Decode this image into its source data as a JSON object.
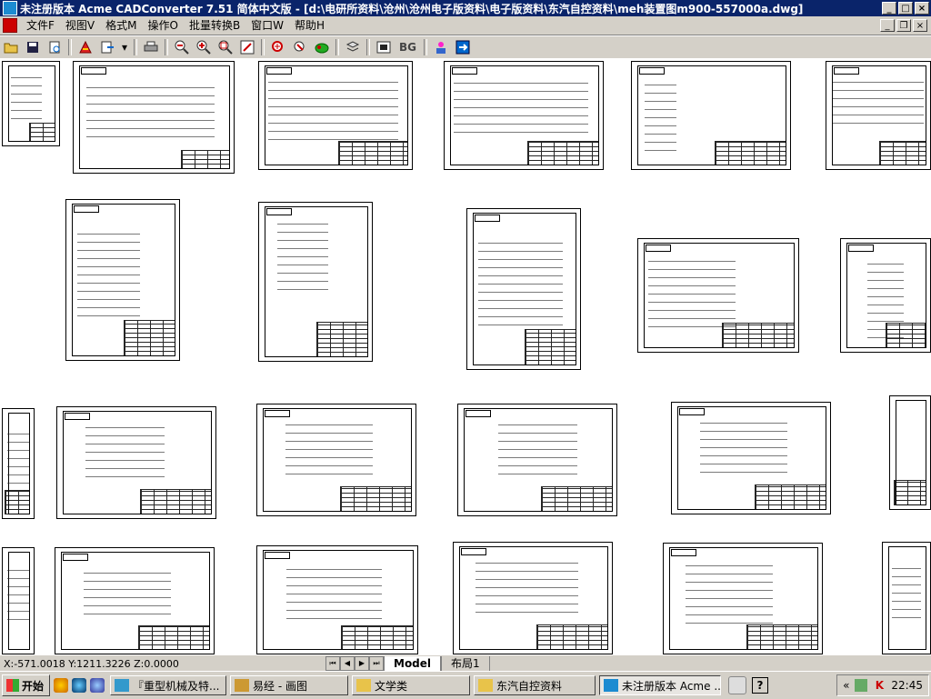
{
  "window": {
    "title": "未注册版本 Acme CADConverter 7.51 简体中文版 - [d:\\电研所资料\\沧州\\沧州电子版资料\\电子版资料\\东汽自控资料\\meh装置图m900-557000a.dwg]"
  },
  "menu": [
    "文件F",
    "视图V",
    "格式M",
    "操作O",
    "批量转换B",
    "窗口W",
    "帮助H"
  ],
  "toolbar": {
    "icons": [
      "open-icon",
      "save-icon",
      "print-preview-icon",
      "convert-icon",
      "export-icon",
      "print-icon",
      "zoom-out-icon",
      "zoom-in-icon",
      "zoom-window-icon",
      "pan-icon",
      "zoom-realtime-icon",
      "zoom-previous-icon",
      "zoom-extents-icon",
      "layers-icon",
      "background-icon",
      "about-icon",
      "exit-icon"
    ],
    "bg_label": "BG"
  },
  "status": {
    "coords": "X:-571.0018 Y:1211.3226 Z:0.0000"
  },
  "layout_tabs": [
    "Model",
    "布局1"
  ],
  "taskbar": {
    "start_label": "开始",
    "tasks": [
      {
        "label": "『重型机械及特...",
        "active": false
      },
      {
        "label": "易经 - 画图",
        "active": false
      },
      {
        "label": "文学类",
        "active": false
      },
      {
        "label": "东汽自控资料",
        "active": false
      },
      {
        "label": "未注册版本 Acme ...",
        "active": true
      }
    ],
    "clock": "22:45"
  },
  "colors": {
    "title_bg": "#0a246a",
    "chrome": "#d4d0c8",
    "canvas": "#ffffff"
  }
}
